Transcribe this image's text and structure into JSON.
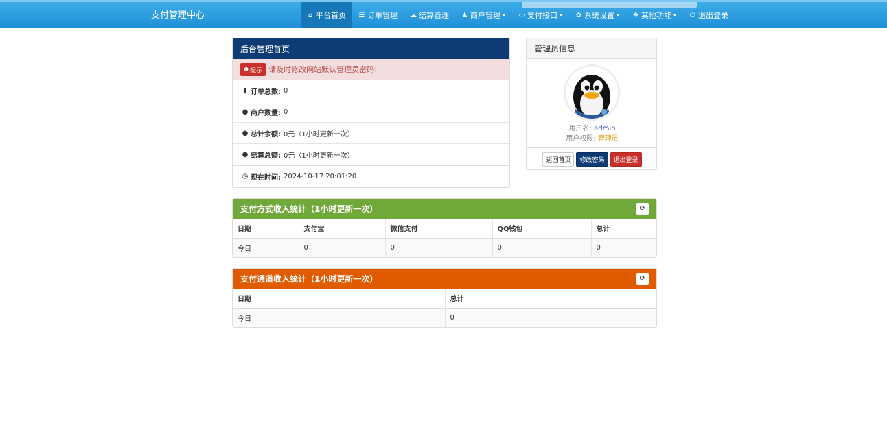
{
  "navbar": {
    "brand": "支付管理中心",
    "items": [
      {
        "icon": "home-icon",
        "glyph": "⌂",
        "label": "平台首页",
        "active": true,
        "dropdown": false
      },
      {
        "icon": "list-icon",
        "glyph": "☰",
        "label": "订单管理",
        "active": false,
        "dropdown": false
      },
      {
        "icon": "cloud-icon",
        "glyph": "☁",
        "label": "结算管理",
        "active": false,
        "dropdown": false
      },
      {
        "icon": "user-icon",
        "glyph": "♟",
        "label": "商户管理",
        "active": false,
        "dropdown": true
      },
      {
        "icon": "credit-card-icon",
        "glyph": "▭",
        "label": "支付接口",
        "active": false,
        "dropdown": true
      },
      {
        "icon": "gear-icon",
        "glyph": "✿",
        "label": "系统设置",
        "active": false,
        "dropdown": true
      },
      {
        "icon": "cube-icon",
        "glyph": "❖",
        "label": "其他功能",
        "active": false,
        "dropdown": true
      },
      {
        "icon": "power-icon",
        "glyph": "⏻",
        "label": "退出登录",
        "active": false,
        "dropdown": false
      }
    ]
  },
  "home": {
    "title": "后台管理首页",
    "alert_badge": "提示",
    "alert_text": "请及时修改网站默认管理员密码!",
    "rows": {
      "orders": {
        "label": "订单总数:",
        "value": "0"
      },
      "merchants": {
        "label": "商户数量:",
        "value": "0"
      },
      "balance": {
        "label": "总计余额:",
        "value": "0元（1小时更新一次）"
      },
      "settlement": {
        "label": "结算总额:",
        "value": "0元（1小时更新一次）"
      },
      "time": {
        "label": "现在时间:",
        "value": "2024-10-17 20:01:20"
      }
    }
  },
  "admin": {
    "title": "管理员信息",
    "username_label": "用户名:",
    "username": "admin",
    "role_label": "用户权限:",
    "role": "管理员",
    "btn_home": "返回首页",
    "btn_password": "修改密码",
    "btn_logout": "退出登录"
  },
  "pay_method": {
    "title": "支付方式收入统计（1小时更新一次）",
    "headers": [
      "日期",
      "支付宝",
      "微信支付",
      "QQ钱包",
      "总计"
    ],
    "row": [
      "今日",
      "0",
      "0",
      "0",
      "0"
    ]
  },
  "pay_channel": {
    "title": "支付通道收入统计（1小时更新一次）",
    "headers": [
      "日期",
      "总计"
    ],
    "row": [
      "今日",
      "0"
    ]
  },
  "colors": {
    "navbar": "#1e90d8",
    "home_heading": "#0e3b73",
    "pay_method_heading": "#70a839",
    "pay_channel_heading": "#e05a00"
  }
}
